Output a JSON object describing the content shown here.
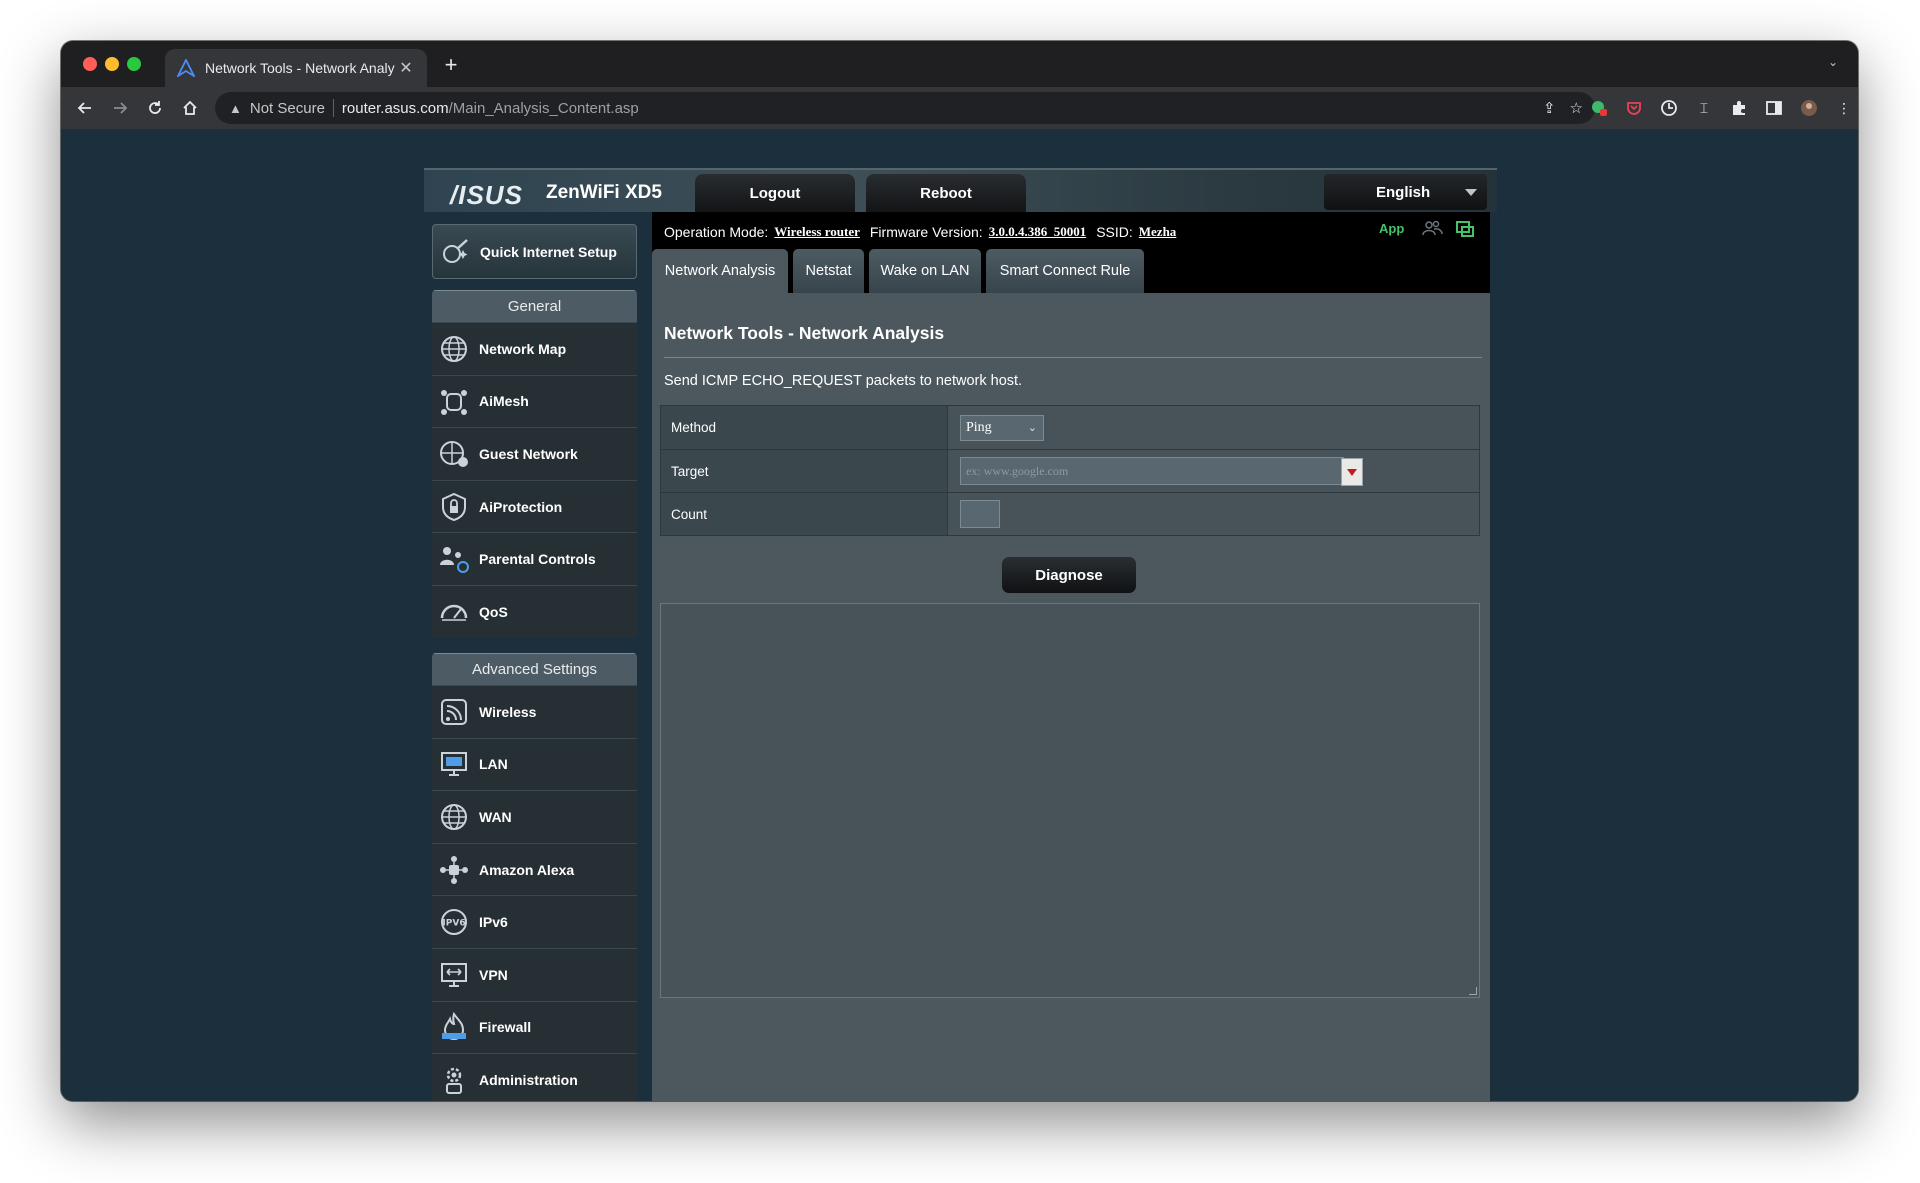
{
  "browser": {
    "tab_title": "Network Tools - Network Analy",
    "tab_close": "✕",
    "new_tab": "+",
    "tab_menu": "⌄",
    "security_label": "Not Secure",
    "url_host": "router.asus.com",
    "url_path": "/Main_Analysis_Content.asp"
  },
  "router": {
    "brand": "/ISUS",
    "model": "ZenWiFi XD5",
    "logout_label": "Logout",
    "reboot_label": "Reboot",
    "language": "English"
  },
  "menu": {
    "quick_setup": "Quick Internet Setup",
    "general_header": "General",
    "general_items": [
      "Network Map",
      "AiMesh",
      "Guest Network",
      "AiProtection",
      "Parental Controls",
      "QoS"
    ],
    "advanced_header": "Advanced Settings",
    "advanced_items": [
      "Wireless",
      "LAN",
      "WAN",
      "Amazon Alexa",
      "IPv6",
      "VPN",
      "Firewall",
      "Administration"
    ]
  },
  "status": {
    "op_mode_label": "Operation Mode:",
    "op_mode_value": "Wireless router",
    "firmware_label": "Firmware Version:",
    "firmware_value": "3.0.0.4.386_50001",
    "ssid_label": "SSID:",
    "ssid_value": "Mezha",
    "app_label": "App"
  },
  "tabs": [
    "Network Analysis",
    "Netstat",
    "Wake on LAN",
    "Smart Connect Rule"
  ],
  "panel": {
    "title": "Network Tools - Network Analysis",
    "description": "Send ICMP ECHO_REQUEST packets to network host.",
    "method_label": "Method",
    "method_value": "Ping",
    "target_label": "Target",
    "target_placeholder": "ex: www.google.com",
    "count_label": "Count",
    "diagnose_label": "Diagnose"
  },
  "colors": {
    "accent_green": "#46c26a",
    "panel_bg": "#4c585e",
    "page_bg": "#1c2f3c"
  }
}
